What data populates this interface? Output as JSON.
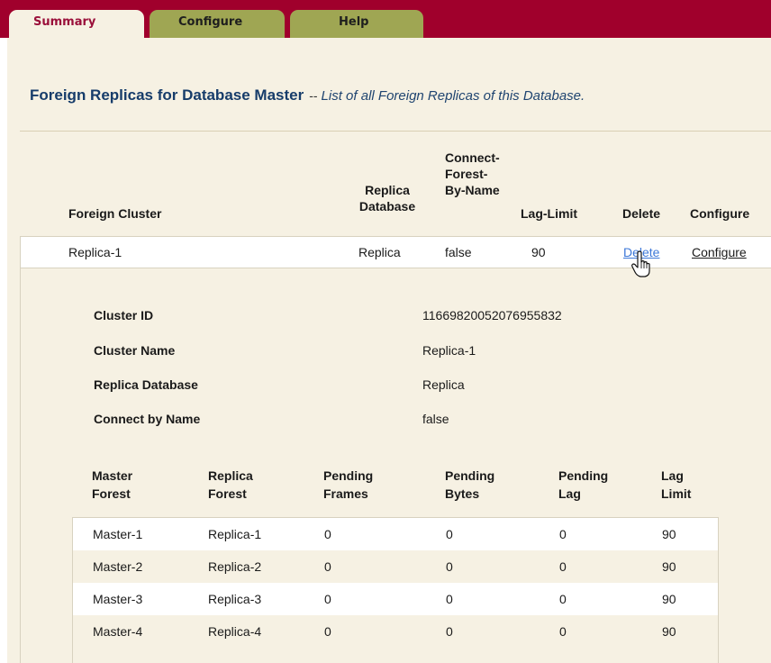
{
  "tabs": {
    "summary": "Summary",
    "configure": "Configure",
    "help": "Help"
  },
  "heading": {
    "title": "Foreign Replicas for Database Master",
    "separator": "--",
    "subtitle": "List of all Foreign Replicas of this Database."
  },
  "replicas": {
    "headers": {
      "foreign_cluster": "Foreign Cluster",
      "replica_database_1": "Replica",
      "replica_database_2": "Database",
      "connect_1": "Connect-",
      "connect_2": "Forest-",
      "connect_3": "By-Name",
      "lag_limit": "Lag-Limit",
      "delete": "Delete",
      "configure": "Configure"
    },
    "row": {
      "foreign_cluster": "Replica-1",
      "replica_database": "Replica",
      "connect_by_name": "false",
      "lag_limit": "90",
      "delete_link": "Delete",
      "configure_link": "Configure"
    }
  },
  "details": {
    "cluster_id_label": "Cluster ID",
    "cluster_id_value": "11669820052076955832",
    "cluster_name_label": "Cluster Name",
    "cluster_name_value": "Replica-1",
    "replica_database_label": "Replica Database",
    "replica_database_value": "Replica",
    "connect_by_name_label": "Connect by Name",
    "connect_by_name_value": "false"
  },
  "forests": {
    "headers": {
      "master_1": "Master",
      "master_2": "Forest",
      "replica_1": "Replica",
      "replica_2": "Forest",
      "frames_1": "Pending",
      "frames_2": "Frames",
      "bytes_1": "Pending",
      "bytes_2": "Bytes",
      "lag_1": "Pending",
      "lag_2": "Lag",
      "limit_1": "Lag",
      "limit_2": "Limit"
    },
    "rows": [
      {
        "master": "Master-1",
        "replica": "Replica-1",
        "frames": "0",
        "bytes": "0",
        "lag": "0",
        "limit": "90"
      },
      {
        "master": "Master-2",
        "replica": "Replica-2",
        "frames": "0",
        "bytes": "0",
        "lag": "0",
        "limit": "90"
      },
      {
        "master": "Master-3",
        "replica": "Replica-3",
        "frames": "0",
        "bytes": "0",
        "lag": "0",
        "limit": "90"
      },
      {
        "master": "Master-4",
        "replica": "Replica-4",
        "frames": "0",
        "bytes": "0",
        "lag": "0",
        "limit": "90"
      }
    ]
  }
}
